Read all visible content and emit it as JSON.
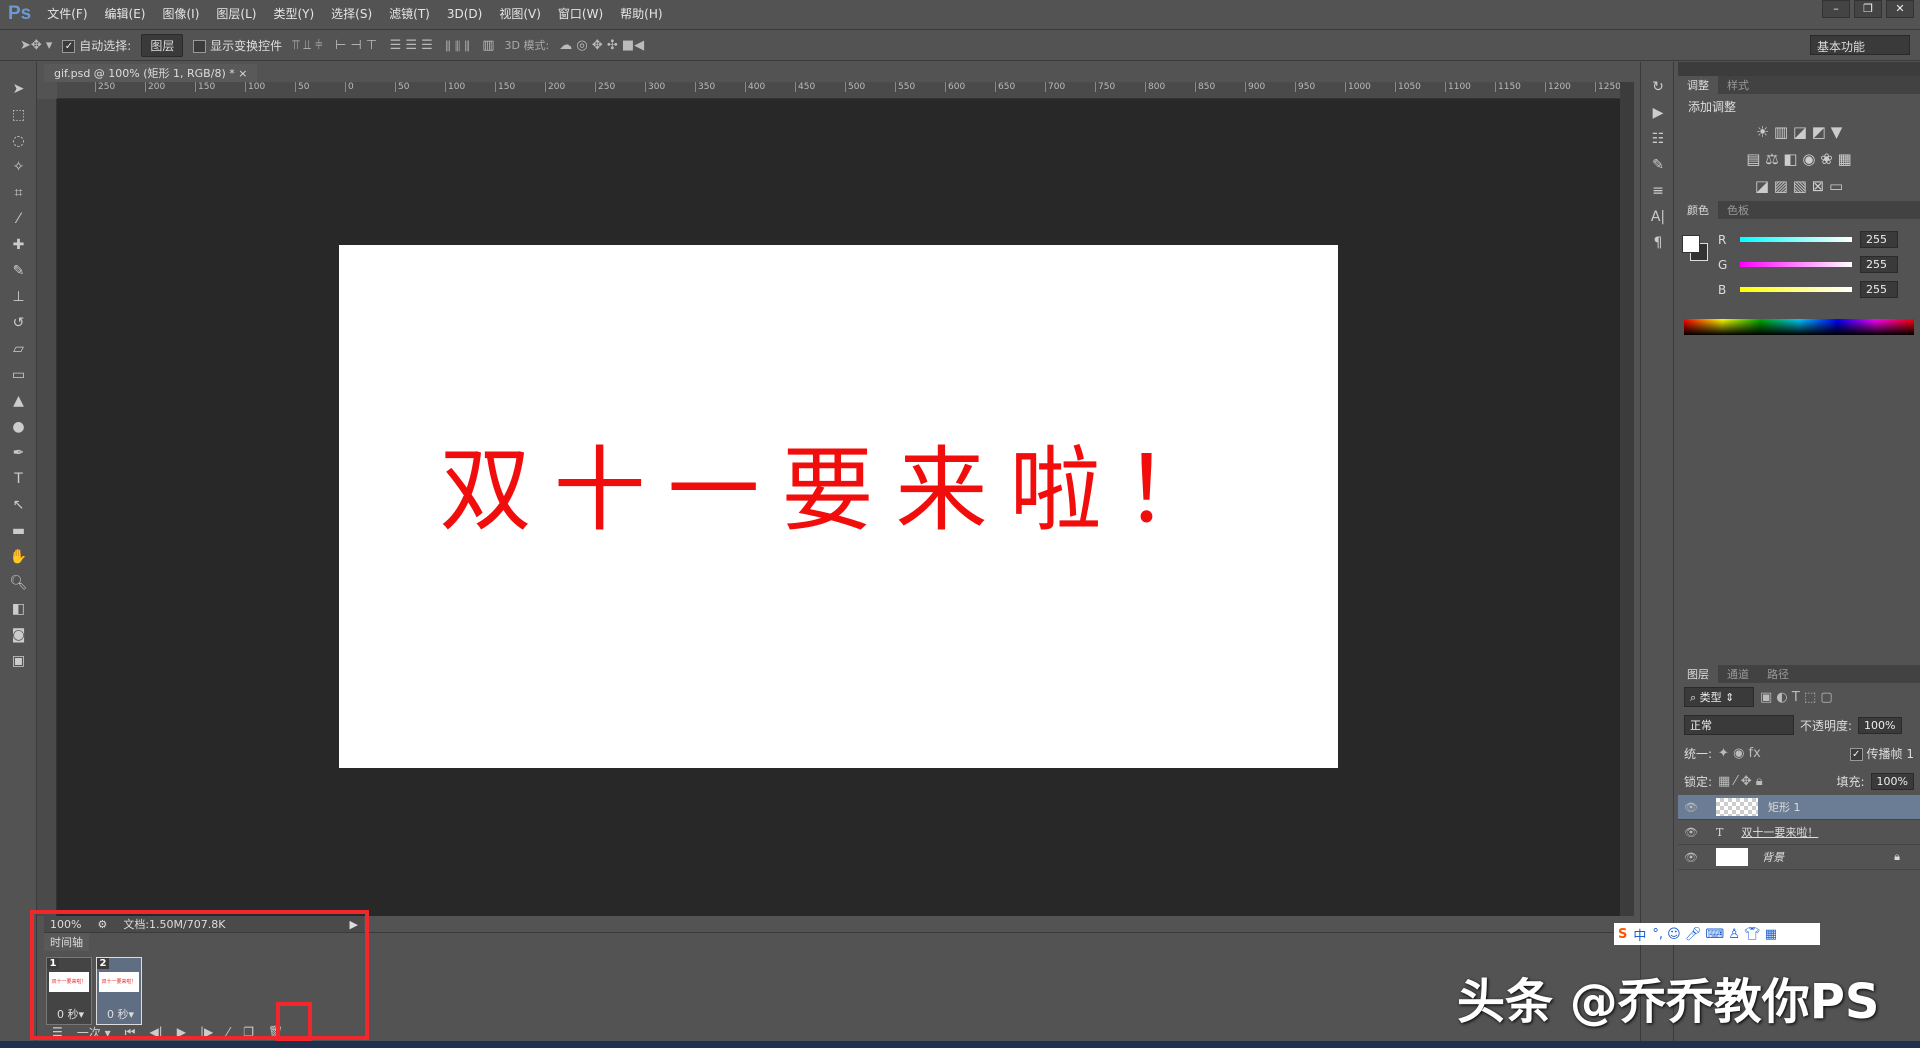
{
  "app": {
    "logo": "Ps",
    "menus": [
      "文件(F)",
      "编辑(E)",
      "图像(I)",
      "图层(L)",
      "类型(Y)",
      "选择(S)",
      "滤镜(T)",
      "3D(D)",
      "视图(V)",
      "窗口(W)",
      "帮助(H)"
    ]
  },
  "options": {
    "auto_select_label": "自动选择:",
    "auto_select_value": "图层",
    "show_transform_label": "显示变换控件",
    "mode_3d_label": "3D 模式:",
    "workspace": "基本功能"
  },
  "document": {
    "tab_title": "gif.psd @ 100% (矩形 1, RGB/8) *",
    "close": "×",
    "ruler_ticks": [
      "250",
      "200",
      "150",
      "100",
      "50",
      "0",
      "50",
      "100",
      "150",
      "200",
      "250",
      "300",
      "350",
      "400",
      "450",
      "500",
      "550",
      "600",
      "650",
      "700",
      "750",
      "800",
      "850",
      "900",
      "950",
      "1000",
      "1050",
      "1100",
      "1150",
      "1200",
      "1250"
    ],
    "canvas_text": "双十一要来啦！"
  },
  "adjustments": {
    "tabs": [
      "调整",
      "样式"
    ],
    "title": "添加调整"
  },
  "color": {
    "tabs": [
      "颜色",
      "色板"
    ],
    "channels": [
      {
        "label": "R",
        "value": "255"
      },
      {
        "label": "G",
        "value": "255"
      },
      {
        "label": "B",
        "value": "255"
      }
    ]
  },
  "layers": {
    "tabs": [
      "图层",
      "通道",
      "路径"
    ],
    "filter": "类型",
    "blend_mode": "正常",
    "opacity_label": "不透明度:",
    "opacity": "100%",
    "unify_label": "统一:",
    "propagate_label": "传播帧",
    "propagate_value": "1",
    "lock_label": "锁定:",
    "fill_label": "填充:",
    "fill": "100%",
    "items": [
      {
        "name": "矩形 1",
        "selected": true
      },
      {
        "name": "双十一要来啦！",
        "type": "T"
      },
      {
        "name": "背景",
        "locked": true
      }
    ]
  },
  "status": {
    "zoom": "100%",
    "doc": "文档:1.50M/707.8K"
  },
  "timeline": {
    "tab": "时间轴",
    "frames": [
      {
        "num": "1",
        "delay": "0 秒▾"
      },
      {
        "num": "2",
        "delay": "0 秒▾"
      }
    ],
    "loop": "一次"
  },
  "ime": {
    "label": "中"
  },
  "watermark": "头条 @乔乔教你PS"
}
